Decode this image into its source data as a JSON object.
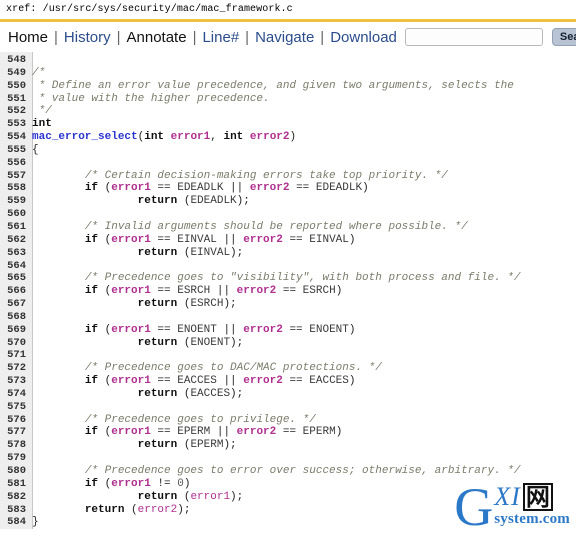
{
  "header": {
    "xref_label": "xref: /usr/src/sys/security/mac/mac_framework.c"
  },
  "menubar": {
    "items": [
      {
        "label": "Home",
        "style": "strong"
      },
      {
        "label": "History",
        "style": "link"
      },
      {
        "label": "Annotate",
        "style": "strong"
      },
      {
        "label": "Line#",
        "style": "link"
      },
      {
        "label": "Navigate",
        "style": "link"
      },
      {
        "label": "Download",
        "style": "link"
      }
    ],
    "separator": "|",
    "search_value": "",
    "search_placeholder": "",
    "search_button": "Search",
    "extra_checkbox": ""
  },
  "code": {
    "language": "c",
    "first_line": 548,
    "last_line": 584,
    "lines": [
      {
        "no": "548",
        "tokens": []
      },
      {
        "no": "549",
        "tokens": [
          {
            "t": "/*",
            "c": "c"
          }
        ]
      },
      {
        "no": "550",
        "tokens": [
          {
            "t": " * Define an error value precedence, and given two arguments, selects the",
            "c": "c"
          }
        ]
      },
      {
        "no": "551",
        "tokens": [
          {
            "t": " * value with the higher precedence.",
            "c": "c"
          }
        ]
      },
      {
        "no": "552",
        "tokens": [
          {
            "t": " */",
            "c": "c"
          }
        ]
      },
      {
        "no": "553",
        "tokens": [
          {
            "t": "int",
            "c": "kw"
          }
        ]
      },
      {
        "no": "554",
        "tokens": [
          {
            "t": "mac_error_select",
            "c": "fn"
          },
          {
            "t": "(",
            "c": "p"
          },
          {
            "t": "int",
            "c": "kw"
          },
          {
            "t": " ",
            "c": "p"
          },
          {
            "t": "error1",
            "c": "v"
          },
          {
            "t": ", ",
            "c": "p"
          },
          {
            "t": "int",
            "c": "kw"
          },
          {
            "t": " ",
            "c": "p"
          },
          {
            "t": "error2",
            "c": "v"
          },
          {
            "t": ")",
            "c": "p"
          }
        ]
      },
      {
        "no": "555",
        "tokens": [
          {
            "t": "{",
            "c": "p"
          }
        ]
      },
      {
        "no": "556",
        "tokens": []
      },
      {
        "no": "557",
        "tokens": [
          {
            "t": "\t",
            "c": "p"
          },
          {
            "t": "/* Certain decision-making errors take top priority. */",
            "c": "c"
          }
        ]
      },
      {
        "no": "558",
        "tokens": [
          {
            "t": "\t",
            "c": "p"
          },
          {
            "t": "if",
            "c": "kw"
          },
          {
            "t": " (",
            "c": "p"
          },
          {
            "t": "error1",
            "c": "v"
          },
          {
            "t": " == ",
            "c": "p"
          },
          {
            "t": "EDEADLK",
            "c": "m"
          },
          {
            "t": " || ",
            "c": "p"
          },
          {
            "t": "error2",
            "c": "v"
          },
          {
            "t": " == ",
            "c": "p"
          },
          {
            "t": "EDEADLK",
            "c": "m"
          },
          {
            "t": ")",
            "c": "p"
          }
        ]
      },
      {
        "no": "559",
        "tokens": [
          {
            "t": "\t\t",
            "c": "p"
          },
          {
            "t": "return",
            "c": "kw"
          },
          {
            "t": " (",
            "c": "p"
          },
          {
            "t": "EDEADLK",
            "c": "m"
          },
          {
            "t": ");",
            "c": "p"
          }
        ]
      },
      {
        "no": "560",
        "tokens": []
      },
      {
        "no": "561",
        "tokens": [
          {
            "t": "\t",
            "c": "p"
          },
          {
            "t": "/* Invalid arguments should be reported where possible. */",
            "c": "c"
          }
        ]
      },
      {
        "no": "562",
        "tokens": [
          {
            "t": "\t",
            "c": "p"
          },
          {
            "t": "if",
            "c": "kw"
          },
          {
            "t": " (",
            "c": "p"
          },
          {
            "t": "error1",
            "c": "v"
          },
          {
            "t": " == ",
            "c": "p"
          },
          {
            "t": "EINVAL",
            "c": "m"
          },
          {
            "t": " || ",
            "c": "p"
          },
          {
            "t": "error2",
            "c": "v"
          },
          {
            "t": " == ",
            "c": "p"
          },
          {
            "t": "EINVAL",
            "c": "m"
          },
          {
            "t": ")",
            "c": "p"
          }
        ]
      },
      {
        "no": "563",
        "tokens": [
          {
            "t": "\t\t",
            "c": "p"
          },
          {
            "t": "return",
            "c": "kw"
          },
          {
            "t": " (",
            "c": "p"
          },
          {
            "t": "EINVAL",
            "c": "m"
          },
          {
            "t": ");",
            "c": "p"
          }
        ]
      },
      {
        "no": "564",
        "tokens": []
      },
      {
        "no": "565",
        "tokens": [
          {
            "t": "\t",
            "c": "p"
          },
          {
            "t": "/* Precedence goes to \"visibility\", with both process and file. */",
            "c": "c"
          }
        ]
      },
      {
        "no": "566",
        "tokens": [
          {
            "t": "\t",
            "c": "p"
          },
          {
            "t": "if",
            "c": "kw"
          },
          {
            "t": " (",
            "c": "p"
          },
          {
            "t": "error1",
            "c": "v"
          },
          {
            "t": " == ",
            "c": "p"
          },
          {
            "t": "ESRCH",
            "c": "m"
          },
          {
            "t": " || ",
            "c": "p"
          },
          {
            "t": "error2",
            "c": "v"
          },
          {
            "t": " == ",
            "c": "p"
          },
          {
            "t": "ESRCH",
            "c": "m"
          },
          {
            "t": ")",
            "c": "p"
          }
        ]
      },
      {
        "no": "567",
        "tokens": [
          {
            "t": "\t\t",
            "c": "p"
          },
          {
            "t": "return",
            "c": "kw"
          },
          {
            "t": " (",
            "c": "p"
          },
          {
            "t": "ESRCH",
            "c": "m"
          },
          {
            "t": ");",
            "c": "p"
          }
        ]
      },
      {
        "no": "568",
        "tokens": []
      },
      {
        "no": "569",
        "tokens": [
          {
            "t": "\t",
            "c": "p"
          },
          {
            "t": "if",
            "c": "kw"
          },
          {
            "t": " (",
            "c": "p"
          },
          {
            "t": "error1",
            "c": "v"
          },
          {
            "t": " == ",
            "c": "p"
          },
          {
            "t": "ENOENT",
            "c": "m"
          },
          {
            "t": " || ",
            "c": "p"
          },
          {
            "t": "error2",
            "c": "v"
          },
          {
            "t": " == ",
            "c": "p"
          },
          {
            "t": "ENOENT",
            "c": "m"
          },
          {
            "t": ")",
            "c": "p"
          }
        ]
      },
      {
        "no": "570",
        "tokens": [
          {
            "t": "\t\t",
            "c": "p"
          },
          {
            "t": "return",
            "c": "kw"
          },
          {
            "t": " (",
            "c": "p"
          },
          {
            "t": "ENOENT",
            "c": "m"
          },
          {
            "t": ");",
            "c": "p"
          }
        ]
      },
      {
        "no": "571",
        "tokens": []
      },
      {
        "no": "572",
        "tokens": [
          {
            "t": "\t",
            "c": "p"
          },
          {
            "t": "/* Precedence goes to DAC/MAC protections. */",
            "c": "c"
          }
        ]
      },
      {
        "no": "573",
        "tokens": [
          {
            "t": "\t",
            "c": "p"
          },
          {
            "t": "if",
            "c": "kw"
          },
          {
            "t": " (",
            "c": "p"
          },
          {
            "t": "error1",
            "c": "v"
          },
          {
            "t": " == ",
            "c": "p"
          },
          {
            "t": "EACCES",
            "c": "m"
          },
          {
            "t": " || ",
            "c": "p"
          },
          {
            "t": "error2",
            "c": "v"
          },
          {
            "t": " == ",
            "c": "p"
          },
          {
            "t": "EACCES",
            "c": "m"
          },
          {
            "t": ")",
            "c": "p"
          }
        ]
      },
      {
        "no": "574",
        "tokens": [
          {
            "t": "\t\t",
            "c": "p"
          },
          {
            "t": "return",
            "c": "kw"
          },
          {
            "t": " (",
            "c": "p"
          },
          {
            "t": "EACCES",
            "c": "m"
          },
          {
            "t": ");",
            "c": "p"
          }
        ]
      },
      {
        "no": "575",
        "tokens": []
      },
      {
        "no": "576",
        "tokens": [
          {
            "t": "\t",
            "c": "p"
          },
          {
            "t": "/* Precedence goes to privilege. */",
            "c": "c"
          }
        ]
      },
      {
        "no": "577",
        "tokens": [
          {
            "t": "\t",
            "c": "p"
          },
          {
            "t": "if",
            "c": "kw"
          },
          {
            "t": " (",
            "c": "p"
          },
          {
            "t": "error1",
            "c": "v"
          },
          {
            "t": " == ",
            "c": "p"
          },
          {
            "t": "EPERM",
            "c": "m"
          },
          {
            "t": " || ",
            "c": "p"
          },
          {
            "t": "error2",
            "c": "v"
          },
          {
            "t": " == ",
            "c": "p"
          },
          {
            "t": "EPERM",
            "c": "m"
          },
          {
            "t": ")",
            "c": "p"
          }
        ]
      },
      {
        "no": "578",
        "tokens": [
          {
            "t": "\t\t",
            "c": "p"
          },
          {
            "t": "return",
            "c": "kw"
          },
          {
            "t": " (",
            "c": "p"
          },
          {
            "t": "EPERM",
            "c": "m"
          },
          {
            "t": ");",
            "c": "p"
          }
        ]
      },
      {
        "no": "579",
        "tokens": []
      },
      {
        "no": "580",
        "tokens": [
          {
            "t": "\t",
            "c": "p"
          },
          {
            "t": "/* Precedence goes to error over success; otherwise, arbitrary. */",
            "c": "c"
          }
        ]
      },
      {
        "no": "581",
        "tokens": [
          {
            "t": "\t",
            "c": "p"
          },
          {
            "t": "if",
            "c": "kw"
          },
          {
            "t": " (",
            "c": "p"
          },
          {
            "t": "error1",
            "c": "v"
          },
          {
            "t": " != ",
            "c": "p"
          },
          {
            "t": "0",
            "c": "n"
          },
          {
            "t": ")",
            "c": "p"
          }
        ]
      },
      {
        "no": "582",
        "tokens": [
          {
            "t": "\t\t",
            "c": "p"
          },
          {
            "t": "return",
            "c": "kw"
          },
          {
            "t": " (",
            "c": "p"
          },
          {
            "t": "error1",
            "c": "vr"
          },
          {
            "t": ");",
            "c": "p"
          }
        ]
      },
      {
        "no": "583",
        "tokens": [
          {
            "t": "\t",
            "c": "p"
          },
          {
            "t": "return",
            "c": "kw"
          },
          {
            "t": " (",
            "c": "p"
          },
          {
            "t": "error2",
            "c": "vr"
          },
          {
            "t": ");",
            "c": "p"
          }
        ]
      },
      {
        "no": "584",
        "tokens": [
          {
            "t": "}",
            "c": "p"
          }
        ]
      }
    ]
  },
  "watermark": {
    "big_letter": "G",
    "italic_text": "XI",
    "cjk": "网",
    "domain": "system.com"
  },
  "colors": {
    "rule": "#f0c040",
    "link": "#2b4c8c",
    "gutter": "#eeeeee",
    "comment": "#7b7b6b",
    "variable": "#b03090",
    "function": "#2b35d0",
    "watermark": "#2c78c8"
  }
}
